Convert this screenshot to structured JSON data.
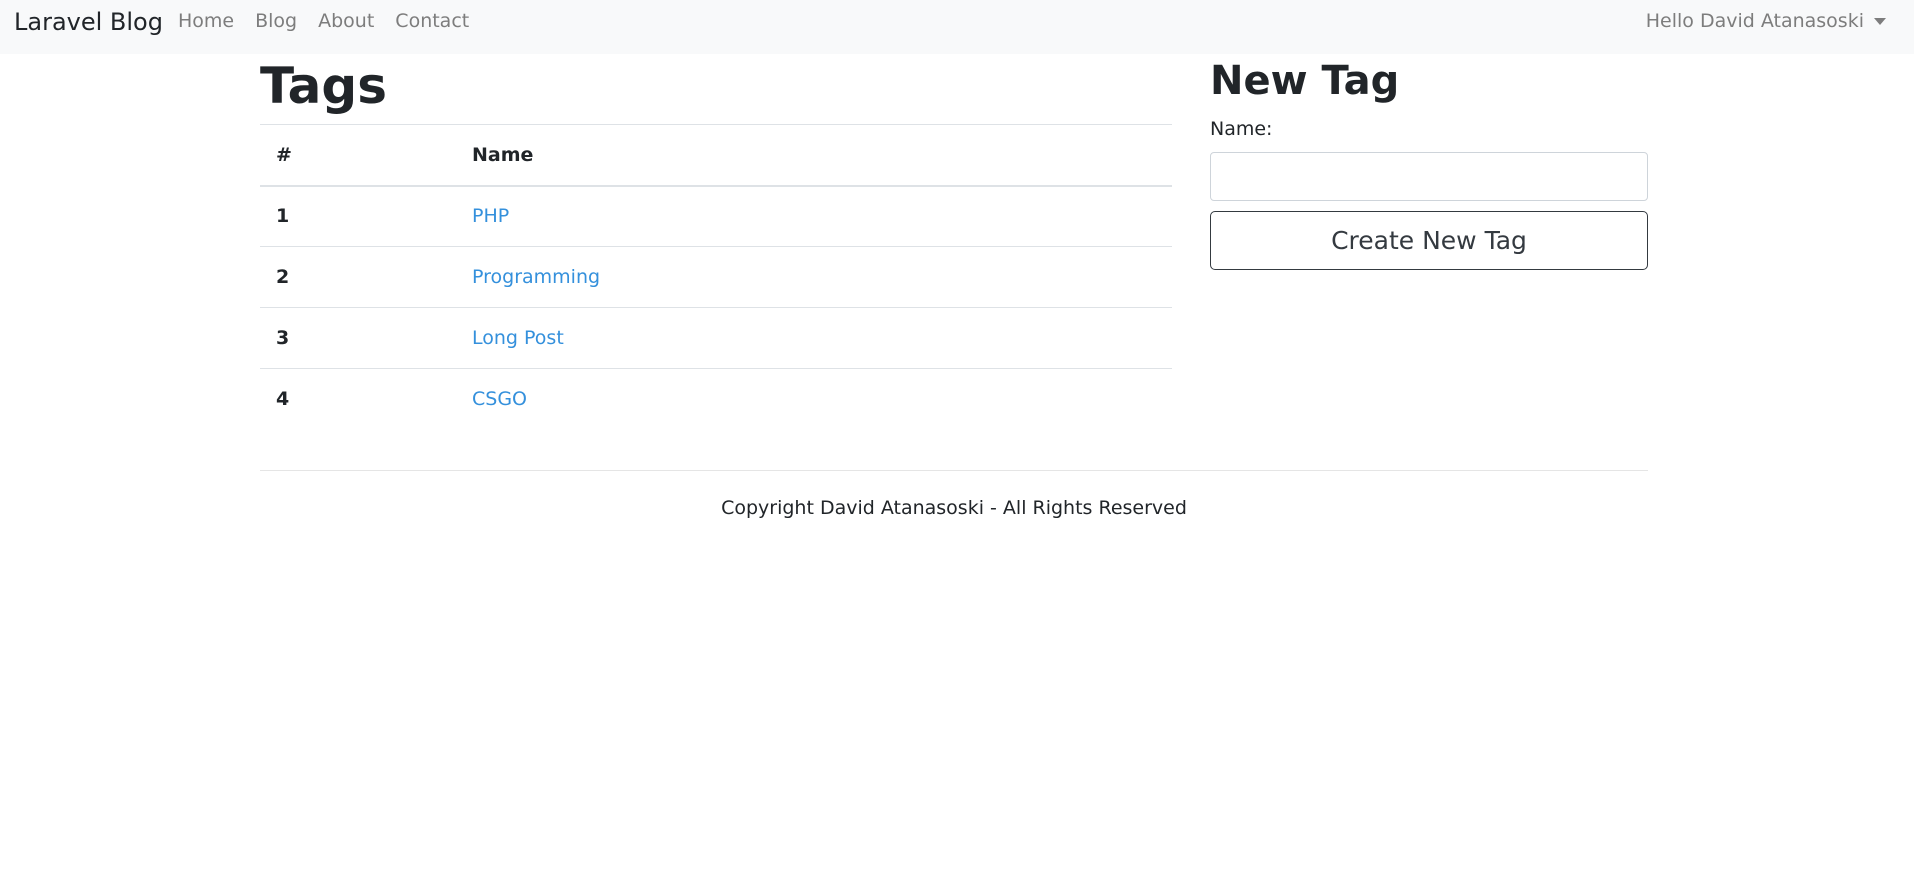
{
  "navbar": {
    "brand": "Laravel Blog",
    "links": [
      "Home",
      "Blog",
      "About",
      "Contact"
    ],
    "user_greeting": "Hello David Atanasoski"
  },
  "tags": {
    "title": "Tags",
    "columns": [
      "#",
      "Name"
    ],
    "rows": [
      {
        "id": "1",
        "name": "PHP"
      },
      {
        "id": "2",
        "name": "Programming"
      },
      {
        "id": "3",
        "name": "Long Post"
      },
      {
        "id": "4",
        "name": "CSGO"
      }
    ]
  },
  "new_tag": {
    "title": "New Tag",
    "name_label": "Name:",
    "name_value": "",
    "submit_label": "Create New Tag"
  },
  "footer": {
    "copyright": "Copyright David Atanasoski - All Rights Reserved"
  },
  "colors": {
    "navbar_bg": "#f8f9fa",
    "link": "#3490dc",
    "text": "#212529",
    "muted": "#7d7d7d"
  }
}
